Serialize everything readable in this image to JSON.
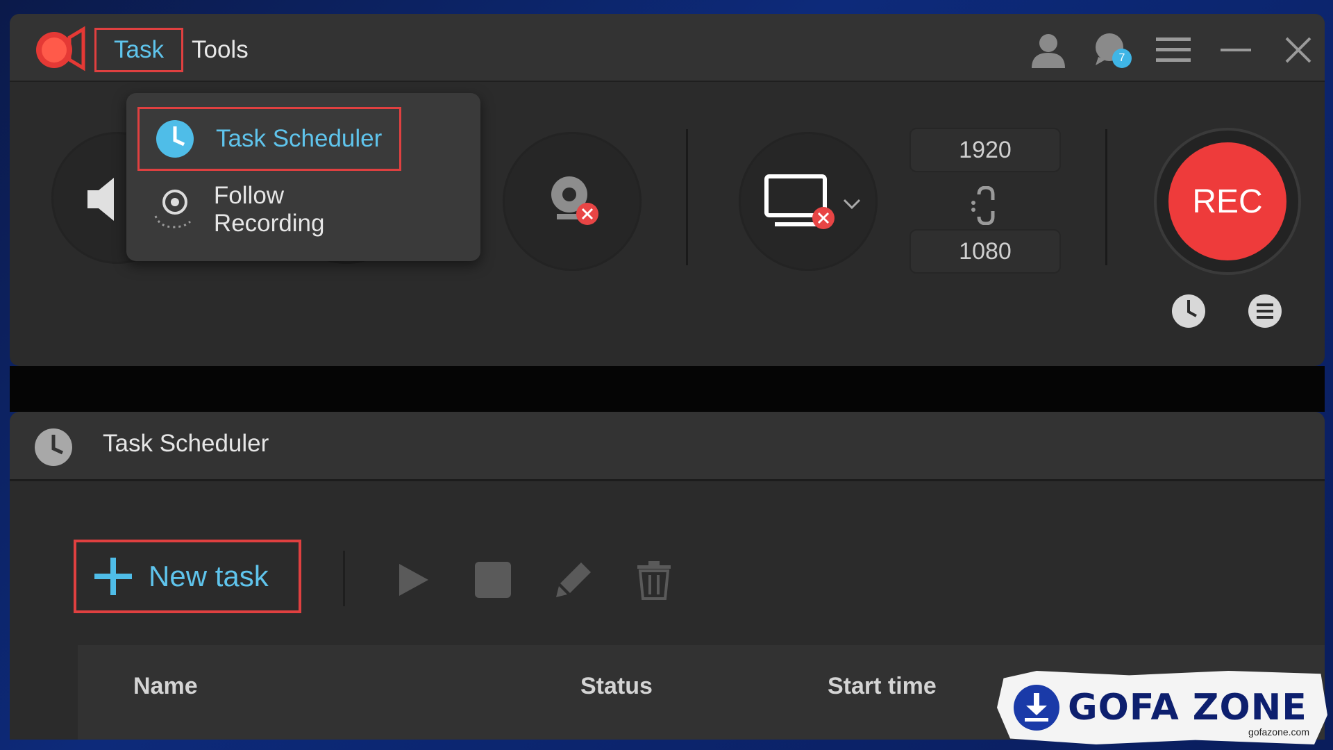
{
  "menu": {
    "task_label": "Task",
    "tools_label": "Tools"
  },
  "titlebar": {
    "notification_count": "7"
  },
  "dropdown": {
    "items": [
      {
        "label": "Task Scheduler"
      },
      {
        "label": "Follow Recording"
      }
    ]
  },
  "recorder": {
    "width": "1920",
    "height": "1080",
    "rec_label": "REC"
  },
  "scheduler": {
    "title": "Task Scheduler",
    "new_task_label": "New task",
    "columns": [
      "Name",
      "Status",
      "Start time"
    ]
  },
  "watermark": {
    "text": "GOFA ZONE",
    "sub": "gofazone.com"
  },
  "colors": {
    "accent_blue": "#5fc4ec",
    "highlight_red": "#e04040",
    "rec_red": "#ee3b3b",
    "panel_bg": "#2b2b2b"
  }
}
